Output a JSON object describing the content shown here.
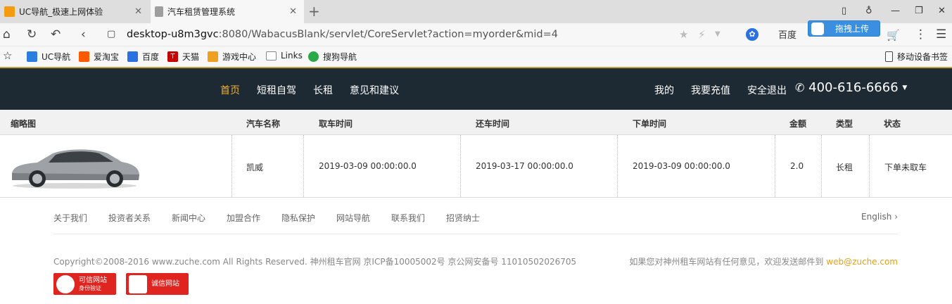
{
  "browser": {
    "tabs": [
      {
        "label": "UC导航_极速上网体验",
        "close": "✕"
      },
      {
        "label": "汽车租赁管理系统",
        "close": "✕"
      }
    ],
    "new_tab": "+",
    "url_host": "desktop-u8m3gvc",
    "url_path": ":8080/WabacusBlank/servlet/CoreServlet?action=myorder&mid=4",
    "search_engine": "百度",
    "upload_button": "拖拽上传",
    "bookmarks": [
      {
        "label": "UC导航",
        "icon": "uc-nav-icon",
        "color": "#2b7de0"
      },
      {
        "label": "爱淘宝",
        "icon": "aitaobao-icon",
        "color": "#ff5a00"
      },
      {
        "label": "百度",
        "icon": "baidu-icon",
        "color": "#2b71e0"
      },
      {
        "label": "天猫",
        "icon": "tmall-icon",
        "color": "#c40000"
      },
      {
        "label": "游戏中心",
        "icon": "game-center-icon",
        "color": "#f0a020"
      },
      {
        "label": "Links",
        "icon": "folder-icon",
        "color": "#999999"
      },
      {
        "label": "搜狗导航",
        "icon": "sogou-icon",
        "color": "#2aa84a"
      }
    ],
    "mobile_bookmarks": "移动设备书签"
  },
  "site": {
    "nav_left": [
      "首页",
      "短租自驾",
      "长租",
      "意见和建议"
    ],
    "nav_right": [
      "我的",
      "我要充值",
      "安全退出"
    ],
    "phone": "400-616-6666",
    "accent_color": "#f5b327",
    "nav_bg": "#1d2933"
  },
  "orders": {
    "columns": [
      "缩略图",
      "汽车名称",
      "取车时间",
      "还车时间",
      "下单时间",
      "金额",
      "类型",
      "状态"
    ],
    "rows": [
      {
        "thumbnail": "silver-sedan-car",
        "car_name": "凯威",
        "pickup_time": "2019-03-09 00:00:00.0",
        "return_time": "2019-03-17 00:00:00.0",
        "order_time": "2019-03-09 00:00:00.0",
        "amount": "2.0",
        "type": "长租",
        "status": "下单未取车"
      }
    ]
  },
  "footer": {
    "links": [
      "关于我们",
      "投资者关系",
      "新闻中心",
      "加盟合作",
      "隐私保护",
      "网站导航",
      "联系我们",
      "招贤纳士"
    ],
    "language": "English ›",
    "copyright": "Copyright©2008-2016 www.zuche.com All Rights Reserved.    神州租车官网 京ICP备10005002号 京公网安备号 11010502026705",
    "feedback_text": "如果您对神州租车网站有任何意见，欢迎发送邮件到",
    "feedback_email": "web@zuche.com",
    "badges": [
      {
        "line1": "可信网站",
        "line2": "身份验证"
      },
      {
        "line1": "诚信网站",
        "line2": ""
      }
    ]
  }
}
